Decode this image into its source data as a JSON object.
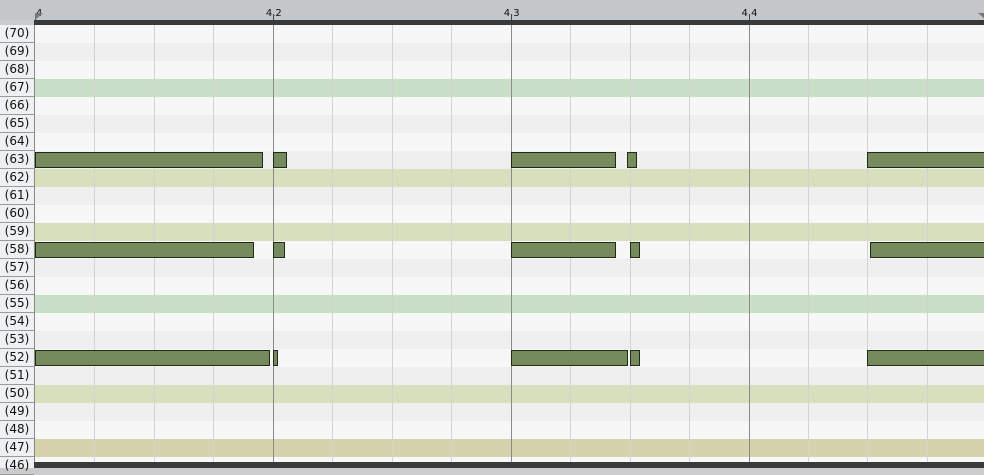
{
  "ruler": {
    "bars": [
      {
        "label": "4",
        "beat": 0
      },
      {
        "label": "4.2",
        "beat": 1
      },
      {
        "label": "4.3",
        "beat": 2
      },
      {
        "label": "4.4",
        "beat": 3
      }
    ],
    "loop_start_beat": 0,
    "loop_end_beat": 4
  },
  "view": {
    "start_beat": 0,
    "end_beat": 3.99,
    "top_pitch": 70,
    "subdivisions_per_beat": 4
  },
  "keys": [
    {
      "pitch": 70,
      "label": "(70)"
    },
    {
      "pitch": 69,
      "label": "(69)"
    },
    {
      "pitch": 68,
      "label": "(68)"
    },
    {
      "pitch": 67,
      "label": "(67)"
    },
    {
      "pitch": 66,
      "label": "(66)"
    },
    {
      "pitch": 65,
      "label": "(65)"
    },
    {
      "pitch": 64,
      "label": "(64)"
    },
    {
      "pitch": 63,
      "label": "(63)"
    },
    {
      "pitch": 62,
      "label": "(62)"
    },
    {
      "pitch": 61,
      "label": "(61)"
    },
    {
      "pitch": 60,
      "label": "(60)"
    },
    {
      "pitch": 59,
      "label": "(59)"
    },
    {
      "pitch": 58,
      "label": "(58)"
    },
    {
      "pitch": 57,
      "label": "(57)"
    },
    {
      "pitch": 56,
      "label": "(56)"
    },
    {
      "pitch": 55,
      "label": "(55)"
    },
    {
      "pitch": 54,
      "label": "(54)"
    },
    {
      "pitch": 53,
      "label": "(53)"
    },
    {
      "pitch": 52,
      "label": "(52)"
    },
    {
      "pitch": 51,
      "label": "(51)"
    },
    {
      "pitch": 50,
      "label": "(50)"
    },
    {
      "pitch": 49,
      "label": "(49)"
    },
    {
      "pitch": 48,
      "label": "(48)"
    },
    {
      "pitch": 47,
      "label": "(47)"
    },
    {
      "pitch": 46,
      "label": "(46)"
    }
  ],
  "scale_highlights": [
    {
      "pitch": 67,
      "color": "#c9dfc7"
    },
    {
      "pitch": 62,
      "color": "#d8dfbc"
    },
    {
      "pitch": 59,
      "color": "#d8dfbc"
    },
    {
      "pitch": 55,
      "color": "#c9dfc7"
    },
    {
      "pitch": 50,
      "color": "#d8dfbc"
    },
    {
      "pitch": 47,
      "color": "#d7d2ae"
    }
  ],
  "colors": {
    "row_light": "#f7f7f7",
    "row_dark": "#efefef",
    "note_fill": "#758b5d",
    "note_border": "#1f2a17",
    "beat_line": "#8a8a8a",
    "sub_line": "#d3d3d3"
  },
  "notes": [
    {
      "pitch": 63,
      "start": 0.0,
      "length": 0.96
    },
    {
      "pitch": 63,
      "start": 1.0,
      "length": 0.06
    },
    {
      "pitch": 63,
      "start": 2.0,
      "length": 0.44
    },
    {
      "pitch": 63,
      "start": 2.49,
      "length": 0.04
    },
    {
      "pitch": 63,
      "start": 3.5,
      "length": 0.5
    },
    {
      "pitch": 58,
      "start": 0.0,
      "length": 0.92
    },
    {
      "pitch": 58,
      "start": 1.0,
      "length": 0.05
    },
    {
      "pitch": 58,
      "start": 2.0,
      "length": 0.44
    },
    {
      "pitch": 58,
      "start": 2.5,
      "length": 0.04
    },
    {
      "pitch": 58,
      "start": 3.51,
      "length": 0.49
    },
    {
      "pitch": 52,
      "start": 0.0,
      "length": 0.99
    },
    {
      "pitch": 52,
      "start": 1.0,
      "length": 0.02
    },
    {
      "pitch": 52,
      "start": 2.0,
      "length": 0.49
    },
    {
      "pitch": 52,
      "start": 2.5,
      "length": 0.04
    },
    {
      "pitch": 52,
      "start": 3.5,
      "length": 0.5
    }
  ]
}
